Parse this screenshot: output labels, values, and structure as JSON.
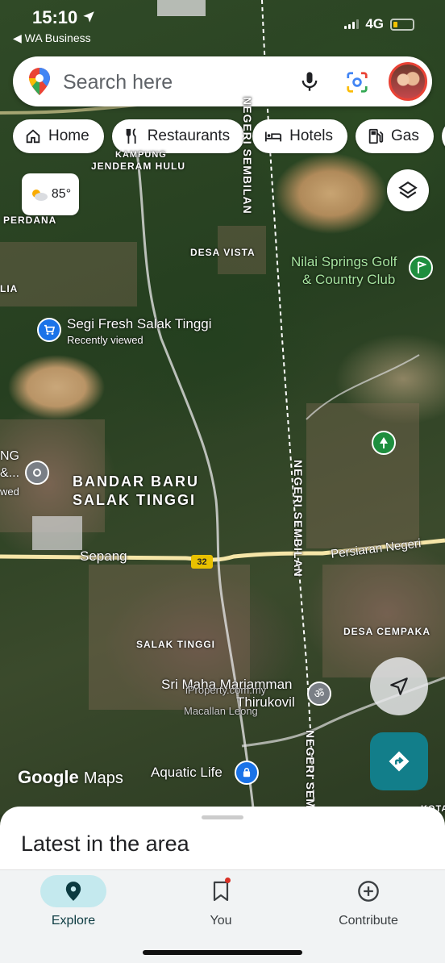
{
  "status_bar": {
    "time": "15:10",
    "back_app": "◀ WA Business",
    "network": "4G"
  },
  "search": {
    "placeholder": "Search here"
  },
  "chips": [
    {
      "label": "Home",
      "icon": "home-icon"
    },
    {
      "label": "Restaurants",
      "icon": "restaurant-icon"
    },
    {
      "label": "Hotels",
      "icon": "hotel-icon"
    },
    {
      "label": "Gas",
      "icon": "gas-icon"
    }
  ],
  "weather": {
    "temp": "85°",
    "icon": "partly-cloudy-icon"
  },
  "map_labels": {
    "kampung": "KAMPUNG",
    "jenderam_hulu": "JENDERAM HULU",
    "perdana": "PERDANA",
    "lia": "LIA",
    "desa_vista": "DESA VISTA",
    "nilai_springs_1": "Nilai Springs Golf",
    "nilai_springs_2": "& Country Club",
    "segi_fresh": "Segi Fresh Salak Tinggi",
    "recently_viewed": "Recently viewed",
    "bandar_baru_1": "BANDAR BARU",
    "bandar_baru_2": "SALAK TINGGI",
    "ng": "NG",
    "ng_amp": "&...",
    "wed": "wed",
    "sepang": "Sepang",
    "highway": "32",
    "persiaran_negeri": "Persiaran Negeri",
    "negeri_sembilan_top": "NEGERI SEMBILAN",
    "negeri_sembilan_mid": "NEGERI SEMBILAN",
    "negeri_sembilan_bottom": "NEGERI SEM",
    "desa_cempaka": "DESA CEMPAKA",
    "salak_tinggi": "SALAK TINGGI",
    "sri_maha": "Sri Maha Mariamman",
    "iproperty": "iProperty.com.my",
    "thirukovil": "Thirukovil",
    "macallan": "Macallan Leong",
    "aquatic_life": "Aquatic Life",
    "kota": "KOTA"
  },
  "branding": {
    "google": "Google",
    "maps": "Maps"
  },
  "sheet": {
    "title": "Latest in the area"
  },
  "nav": [
    {
      "label": "Explore",
      "icon": "location-pin-icon",
      "active": true
    },
    {
      "label": "You",
      "icon": "bookmark-icon",
      "active": false
    },
    {
      "label": "Contribute",
      "icon": "add-circle-icon",
      "active": false
    }
  ],
  "colors": {
    "accent": "#127e8a",
    "explore_active_bg": "#c4e9ee",
    "highway_shield": "#e9c100",
    "poi_blue": "#1a73e8"
  }
}
